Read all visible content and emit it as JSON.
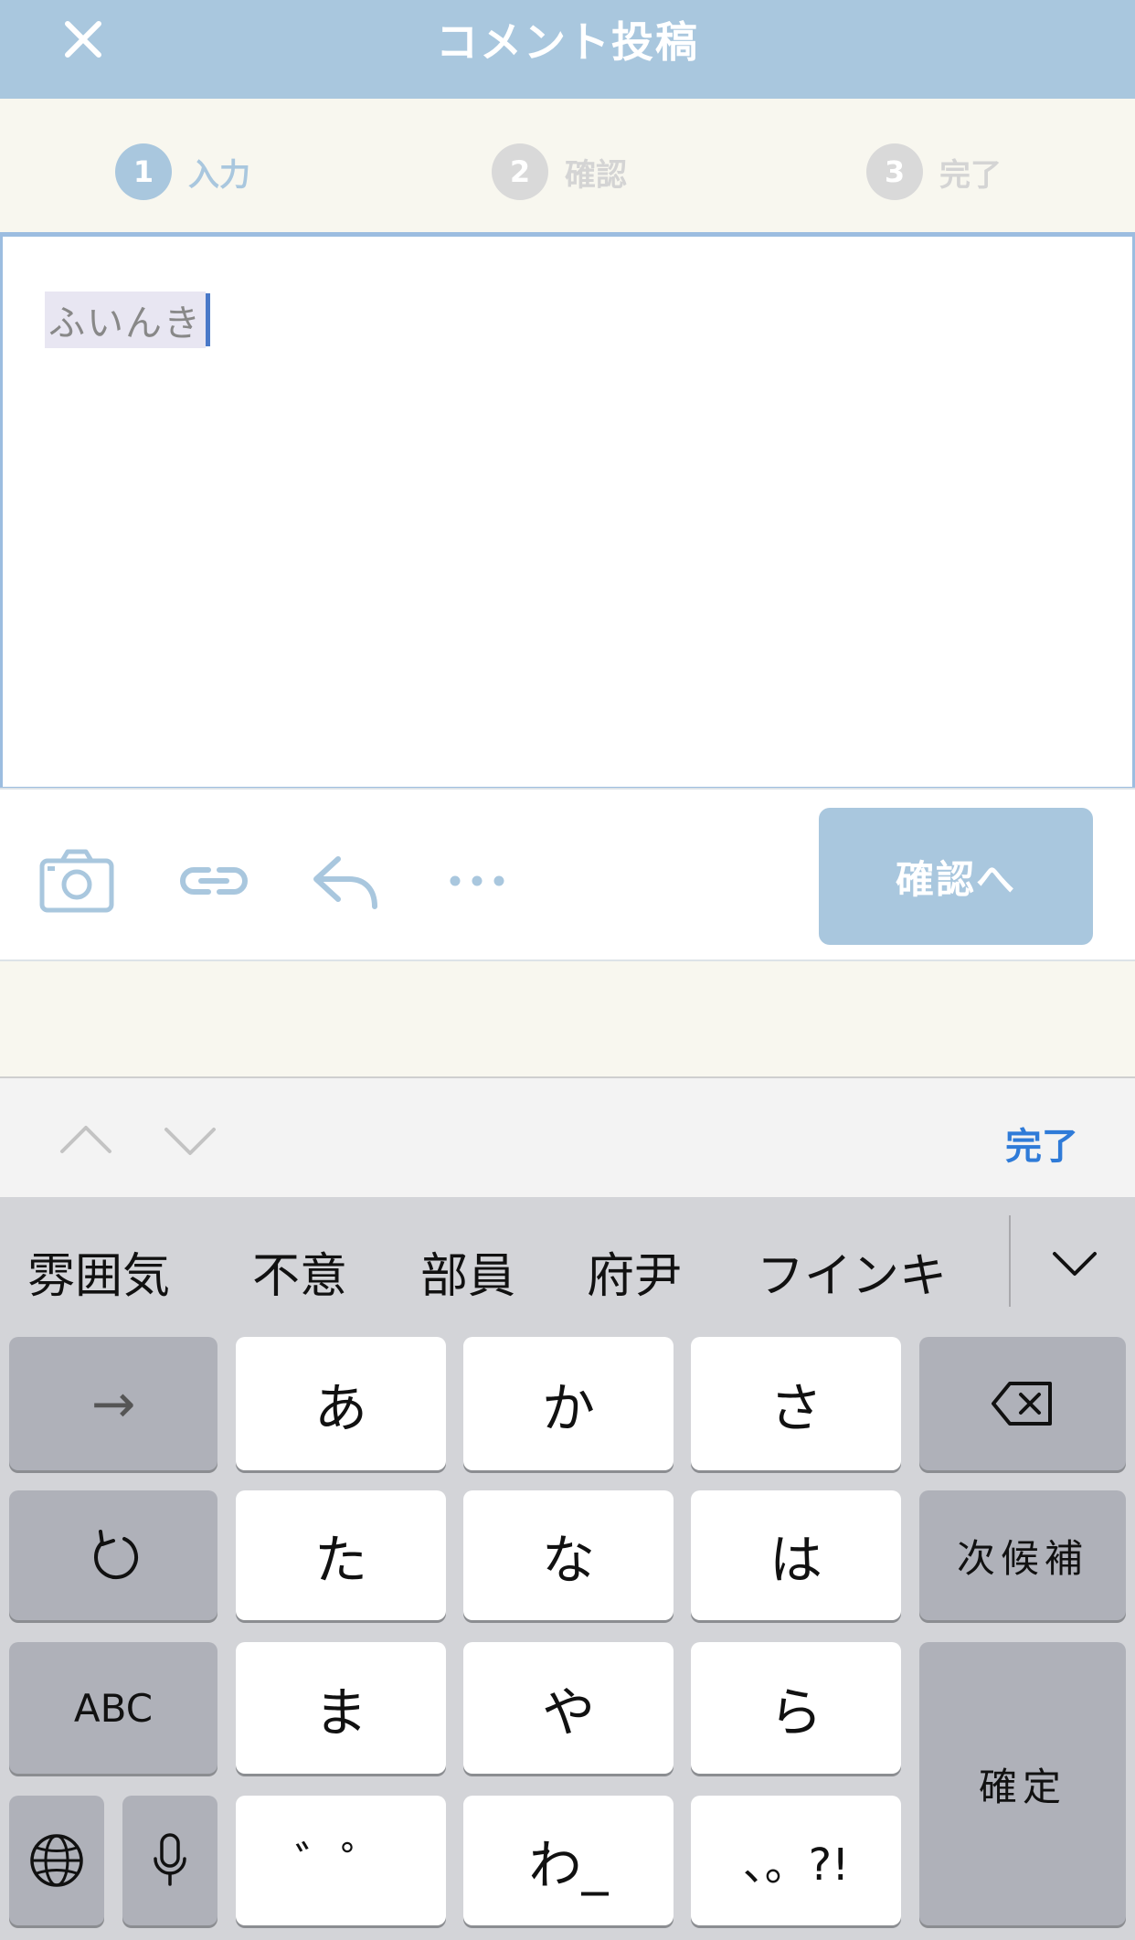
{
  "header": {
    "title": "コメント投稿"
  },
  "steps": [
    {
      "number": "1",
      "label": "入力",
      "state": "active"
    },
    {
      "number": "2",
      "label": "確認",
      "state": "inactive"
    },
    {
      "number": "3",
      "label": "完了",
      "state": "inactive"
    }
  ],
  "composer": {
    "composition_text": "ふいんき"
  },
  "toolbar": {
    "icons": [
      "camera-icon",
      "link-icon",
      "reply-icon",
      "more-icon"
    ],
    "confirm_label": "確認へ"
  },
  "accessory": {
    "done_label": "完了"
  },
  "keyboard": {
    "candidates": [
      "雰囲気",
      "不意",
      "部員",
      "府尹",
      "フインキ"
    ],
    "keys": {
      "arrow": "→",
      "a": "あ",
      "ka": "か",
      "sa": "さ",
      "ta": "た",
      "na": "な",
      "ha": "は",
      "next_candidate": "次候補",
      "abc": "ABC",
      "ma": "ま",
      "ya": "や",
      "ra": "ら",
      "confirm": "確定",
      "dakuten": "゛゜",
      "wa": "わ_",
      "punct": "、。?!"
    }
  },
  "colors": {
    "accent": "#a9c7de",
    "link": "#2f7bd8",
    "caret": "#4a79c8"
  }
}
